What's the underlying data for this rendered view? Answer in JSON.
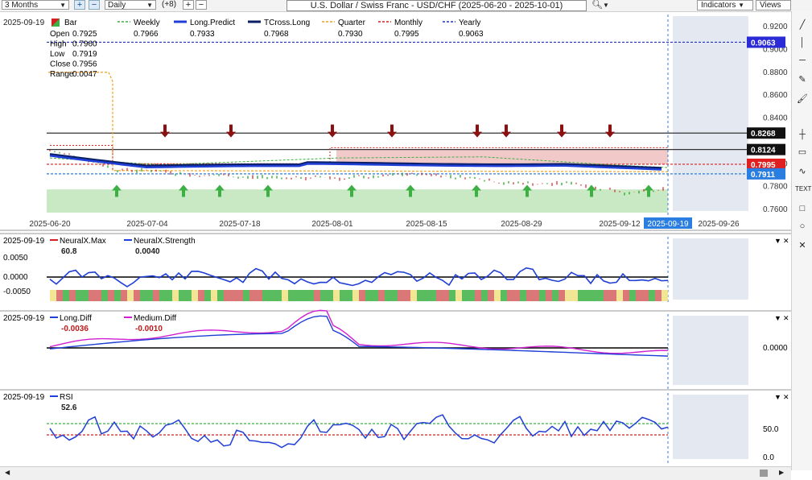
{
  "toolbar": {
    "range": "3 Months",
    "interval": "Daily",
    "overlay_count": "(+8)",
    "title": "U.S. Dollar / Swiss Franc - USD/CHF (2025-06-20 - 2025-10-01)",
    "indicators_label": "Indicators",
    "views_label": "Views"
  },
  "main": {
    "date": "2025-09-19",
    "bar_label": "Bar",
    "ohlc": [
      {
        "k": "Open",
        "v": "0.7925"
      },
      {
        "k": "High",
        "v": "0.7960"
      },
      {
        "k": "Low",
        "v": "0.7919"
      },
      {
        "k": "Close",
        "v": "0.7956"
      },
      {
        "k": "Range",
        "v": "0.0047"
      }
    ],
    "legend": [
      {
        "name": "Weekly",
        "value": "0.7966",
        "color": "#3cb043",
        "style": "dashed"
      },
      {
        "name": "Long.Predict",
        "value": "0.7933",
        "color": "#1f3fd6",
        "style": "solid"
      },
      {
        "name": "TCross.Long",
        "value": "0.7968",
        "color": "#0b1f66",
        "style": "solid"
      },
      {
        "name": "Quarter",
        "value": "0.7930",
        "color": "#f0a020",
        "style": "dashed"
      },
      {
        "name": "Monthly",
        "value": "0.7995",
        "color": "#d42020",
        "style": "dashed"
      },
      {
        "name": "Yearly",
        "value": "0.9063",
        "color": "#2030c0",
        "style": "dashed"
      }
    ],
    "y_ticks": [
      "0.9200",
      "0.9000",
      "0.8800",
      "0.8600",
      "0.8400",
      "0.8000",
      "0.7800",
      "0.7600"
    ],
    "price_labels": [
      {
        "text": "0.9063",
        "bg": "#2a2ad6"
      },
      {
        "text": "0.8268",
        "bg": "#111111"
      },
      {
        "text": "0.8124",
        "bg": "#111111"
      },
      {
        "text": "0.7995",
        "bg": "#e02020"
      },
      {
        "text": "0.7911",
        "bg": "#2a7de1"
      }
    ],
    "x_ticks": [
      "2025-06-20",
      "2025-07-04",
      "2025-07-18",
      "2025-08-01",
      "2025-08-15",
      "2025-08-29",
      "2025-09-12",
      "2025-09-19",
      "2025-09-26"
    ]
  },
  "neural": {
    "date": "2025-09-19",
    "series": [
      {
        "name": "NeuralX.Max",
        "value": "60.8",
        "color": "#d42020"
      },
      {
        "name": "NeuralX.Strength",
        "value": "0.0040",
        "color": "#1f3fd6"
      }
    ],
    "y_ticks": [
      "0.0050",
      "0.0000",
      "-0.0050"
    ]
  },
  "diff": {
    "date": "2025-09-19",
    "series": [
      {
        "name": "Long.Diff",
        "value": "-0.0036",
        "color": "#1f3fd6"
      },
      {
        "name": "Medium.Diff",
        "value": "-0.0010",
        "color": "#d020d0"
      }
    ],
    "y_ticks": [
      "0.0000"
    ]
  },
  "rsi": {
    "date": "2025-09-19",
    "series": [
      {
        "name": "RSI",
        "value": "52.6",
        "color": "#1f3fd6"
      }
    ],
    "y_ticks": [
      "50.0",
      "0.0"
    ]
  }
}
